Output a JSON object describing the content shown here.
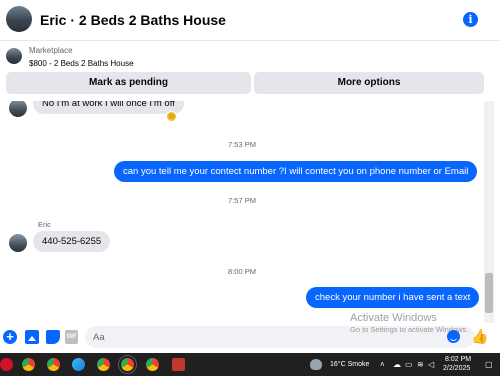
{
  "header": {
    "title": "Eric · 2 Beds 2 Baths House",
    "info_icon": "info-icon"
  },
  "listing": {
    "label": "Marketplace",
    "price_title": "$800 - 2 Beds 2 Baths House",
    "actions": [
      "Mark as pending",
      "More options"
    ]
  },
  "messages": [
    {
      "type": "in",
      "text": "No I'm at work I will once I'm off",
      "reaction": "emoji-reaction"
    },
    {
      "type": "time",
      "text": "7:53 PM"
    },
    {
      "type": "out",
      "text": "can you tell me your contect number ?I will contect you on phone number or Email"
    },
    {
      "type": "time",
      "text": "7:57 PM"
    },
    {
      "type": "sender",
      "text": "Eric"
    },
    {
      "type": "in",
      "text": "440-525-6255"
    },
    {
      "type": "time",
      "text": "8:00 PM"
    },
    {
      "type": "out",
      "text": "check your number i have sent a text"
    }
  ],
  "composer": {
    "placeholder": "Aa",
    "gif_label": "GIF"
  },
  "watermark": {
    "line1": "Activate Windows",
    "line2": "Go to Settings to activate Windows."
  },
  "taskbar": {
    "weather": "16°C  Smoke",
    "time": "8:02 PM",
    "date": "2/2/2025",
    "apps": [
      "opera-icon",
      "chrome-icon",
      "chrome-icon",
      "edge-icon",
      "file-explorer-icon",
      "chrome-icon",
      "chrome-icon",
      "chrome-icon",
      "chrome-icon",
      "app-icon"
    ]
  },
  "colors": {
    "accent": "#0866ff",
    "bubble_in": "#e4e6eb",
    "taskbar": "#202020"
  }
}
